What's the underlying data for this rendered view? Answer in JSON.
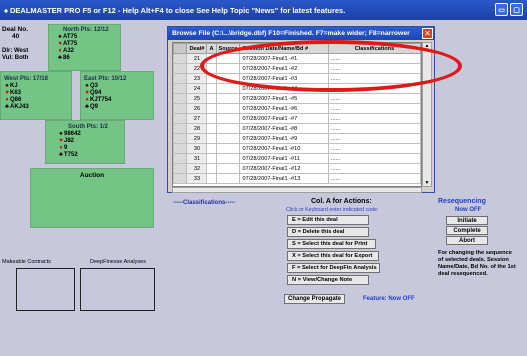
{
  "app": {
    "title": "DEALMASTER PRO  F5 or F12 - Help   Alt+F4 to close  See Help Topic \"News\" for latest features.",
    "spade": "♠"
  },
  "deal": {
    "deal_label": "Deal No.",
    "deal_number": "40",
    "dealer": "Dlr: West",
    "vul": "Vul: Both"
  },
  "hands": {
    "north": {
      "header": "North  Pts: 12/12",
      "spades": "AT75",
      "hearts": "AT75",
      "diamonds": "A32",
      "clubs": "86"
    },
    "west": {
      "header": "West  Pts: 17/18",
      "spades": "KJ",
      "hearts": "K63",
      "diamonds": "Q86",
      "clubs": "AKJ43"
    },
    "east": {
      "header": "East  Pts: 10/12",
      "spades": "Q3",
      "hearts": "Q94",
      "diamonds": "KJT754",
      "clubs": "Q9"
    },
    "south": {
      "header": "South  Pts: 1/2",
      "spades": "98642",
      "hearts": "J82",
      "diamonds": "9",
      "clubs": "T752"
    }
  },
  "auction": {
    "label": "Auction"
  },
  "analyses": {
    "makeable": "Makeable Contracts",
    "deepfinesse": "DeepFinesse Analyses"
  },
  "browse": {
    "title": "Browse File (C:\\...\\bridge.dbf) F10=Finished. F7=make wider; F8=narrower",
    "close": "✕",
    "headers": [
      "Deal#",
      "A",
      "Source",
      "Session Date/Name/Bd #",
      "Classifications"
    ],
    "rows": [
      {
        "deal": "21",
        "session": "07/28/2007-Final1 -#1",
        "cls": "......"
      },
      {
        "deal": "22",
        "session": "07/28/2007-Final1 -#2",
        "cls": "......"
      },
      {
        "deal": "23",
        "session": "07/28/2007-Final1 -#3",
        "cls": "......"
      },
      {
        "deal": "24",
        "session": "07/28/2007-Final1 -#4",
        "cls": "......"
      },
      {
        "deal": "25",
        "session": "07/28/2007-Final1 -#5",
        "cls": "......"
      },
      {
        "deal": "26",
        "session": "07/28/2007-Final1 -#6",
        "cls": "......"
      },
      {
        "deal": "27",
        "session": "07/28/2007-Final1 -#7",
        "cls": "......"
      },
      {
        "deal": "28",
        "session": "07/28/2007-Final1 -#8",
        "cls": "......"
      },
      {
        "deal": "29",
        "session": "07/28/2007-Final1 -#9",
        "cls": "......"
      },
      {
        "deal": "30",
        "session": "07/28/2007-Final1 -#10",
        "cls": "......"
      },
      {
        "deal": "31",
        "session": "07/28/2007-Final1 -#11",
        "cls": "......"
      },
      {
        "deal": "32",
        "session": "07/28/2007-Final1 -#12",
        "cls": "......"
      },
      {
        "deal": "33",
        "session": "07/28/2007-Final1 -#13",
        "cls": "......"
      }
    ]
  },
  "classifications": "-----Classifications-----",
  "actions": {
    "title": "Col. A for Actions:",
    "hint": "Click or Keyboard enter indicated code:",
    "buttons": [
      "E = Edit this deal",
      "D = Delete this deal",
      "S = Select this deal for Print",
      "X = Select this deal for Export",
      "F = Select for DeepFin Analysis",
      "N = View/Change Note"
    ]
  },
  "reseq": {
    "title": "Resequencing",
    "status": "Now OFF",
    "initiate": "Initiate",
    "complete": "Complete",
    "abort": "Abort",
    "note": "For changing the sequence of selected deals. Session Name/Date, Bd No. of the 1st deal resequenced."
  },
  "propagate": {
    "button": "Change Propagate",
    "feature": "Feature: Now OFF"
  },
  "colors": {
    "accent": "#2040c0",
    "hand_bg": "#74c486",
    "highlight": "#e01818"
  }
}
